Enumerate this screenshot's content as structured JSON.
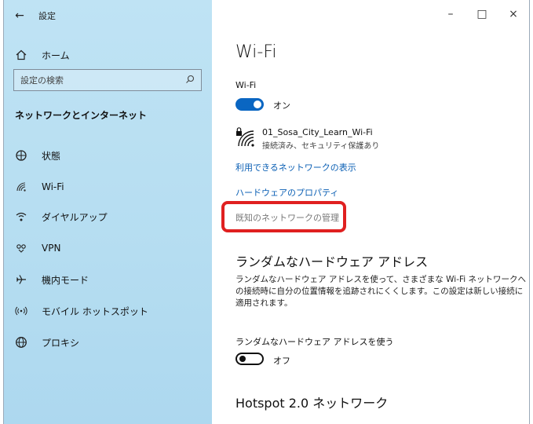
{
  "window": {
    "back_icon": "back-arrow-icon",
    "title": "設定",
    "controls": {
      "minimize": "–",
      "maximize": "□",
      "close": "×"
    }
  },
  "sidebar": {
    "home_label": "ホーム",
    "search_placeholder": "設定の検索",
    "section_title": "ネットワークとインターネット",
    "items": [
      {
        "label": "状態",
        "icon": "globe-status-icon"
      },
      {
        "label": "Wi-Fi",
        "icon": "wifi-icon"
      },
      {
        "label": "ダイヤルアップ",
        "icon": "dialup-icon"
      },
      {
        "label": "VPN",
        "icon": "vpn-icon"
      },
      {
        "label": "機内モード",
        "icon": "airplane-icon"
      },
      {
        "label": "モバイル ホットスポット",
        "icon": "hotspot-icon"
      },
      {
        "label": "プロキシ",
        "icon": "globe-icon"
      }
    ]
  },
  "main": {
    "title": "Wi-Fi",
    "wifi_label": "Wi-Fi",
    "wifi_toggle_state": "オン",
    "network": {
      "name": "01_Sosa_City_Learn_Wi-Fi",
      "status": "接続済み、セキュリティ保護あり"
    },
    "links": {
      "show_available": "利用できるネットワークの表示",
      "hardware_props": "ハードウェアのプロパティ",
      "manage_known": "既知のネットワークの管理"
    },
    "random_hw": {
      "heading": "ランダムなハードウェア アドレス",
      "description": "ランダムなハードウェア アドレスを使って、さまざまな Wi-Fi ネットワークへの接続時に自分の位置情報を追跡されにくくします。この設定は新しい接続に適用されます。",
      "toggle_label": "ランダムなハードウェア アドレスを使う",
      "toggle_state": "オフ"
    },
    "hotspot_heading": "Hotspot 2.0 ネットワーク"
  },
  "colors": {
    "accent": "#0a66c2",
    "highlight": "#e02020",
    "sidebar": "#b5ddf1"
  }
}
